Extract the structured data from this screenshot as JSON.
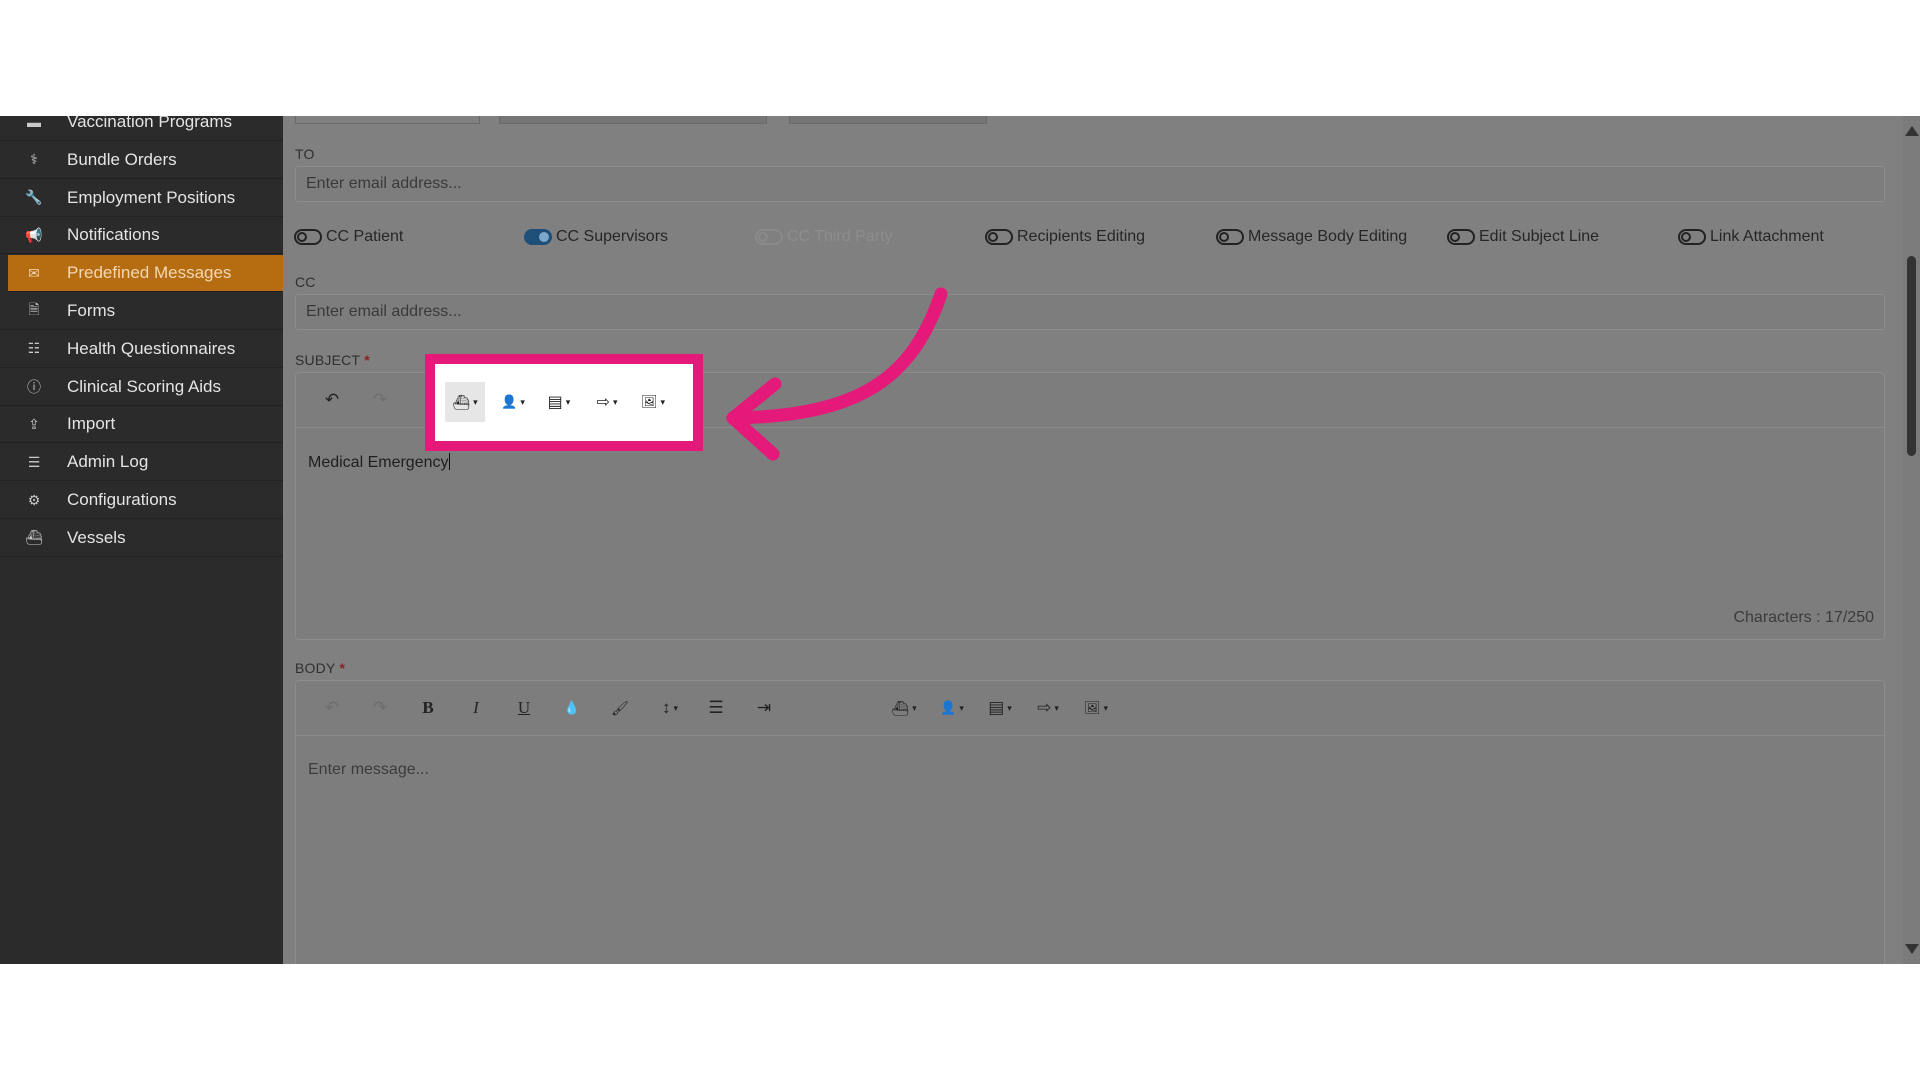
{
  "sidebar": {
    "items": [
      {
        "label": "Vaccination Programs",
        "icon": "briefcase-icon",
        "glyph": "▬"
      },
      {
        "label": "Bundle Orders",
        "icon": "stethoscope-icon",
        "glyph": "⚕"
      },
      {
        "label": "Employment Positions",
        "icon": "wrench-icon",
        "glyph": "🔧"
      },
      {
        "label": "Notifications",
        "icon": "megaphone-icon",
        "glyph": "📢"
      },
      {
        "label": "Predefined Messages",
        "icon": "envelope-icon",
        "glyph": "✉"
      },
      {
        "label": "Forms",
        "icon": "document-icon",
        "glyph": "🗎"
      },
      {
        "label": "Health Questionnaires",
        "icon": "list-icon",
        "glyph": "☷"
      },
      {
        "label": "Clinical Scoring Aids",
        "icon": "info-icon",
        "glyph": "ⓘ"
      },
      {
        "label": "Import",
        "icon": "upload-icon",
        "glyph": "⇪"
      },
      {
        "label": "Admin Log",
        "icon": "sort-list-icon",
        "glyph": "☰"
      },
      {
        "label": "Configurations",
        "icon": "gears-icon",
        "glyph": "⚙"
      },
      {
        "label": "Vessels",
        "icon": "ship-icon",
        "glyph": "⛴"
      }
    ],
    "active_index": 4
  },
  "form": {
    "to_label": "TO",
    "to_placeholder": "Enter email address...",
    "cc_label": "CC",
    "cc_placeholder": "Enter email address...",
    "subject_label": "SUBJECT",
    "subject_text": "Medical Emergency",
    "subject_counter": "Characters : 17/250",
    "body_label": "BODY",
    "body_placeholder": "Enter message...",
    "required_mark": "*"
  },
  "toggles": [
    {
      "label": "CC Patient",
      "on": false,
      "disabled": false
    },
    {
      "label": "CC Supervisors",
      "on": true,
      "disabled": false
    },
    {
      "label": "CC Third Party",
      "on": false,
      "disabled": true
    },
    {
      "label": "Recipients Editing",
      "on": false,
      "disabled": false
    },
    {
      "label": "Message Body Editing",
      "on": false,
      "disabled": false
    },
    {
      "label": "Edit Subject Line",
      "on": false,
      "disabled": false
    },
    {
      "label": "Link Attachment",
      "on": false,
      "disabled": false
    }
  ],
  "icons": {
    "undo": "↶",
    "redo": "↷",
    "bold": "B",
    "italic": "I",
    "underline": "U",
    "droplet": "💧",
    "brush": "🖌",
    "line_height": "↕",
    "list": "☰",
    "indent": "⇥",
    "ship": "⛴",
    "user": "👤",
    "archive": "▤",
    "sign_out": "⇨",
    "image": "🖼",
    "caret": "▾"
  },
  "colors": {
    "highlight": "#e5197a",
    "active_nav": "#b66d11",
    "toggle_on": "#1d4f78"
  }
}
